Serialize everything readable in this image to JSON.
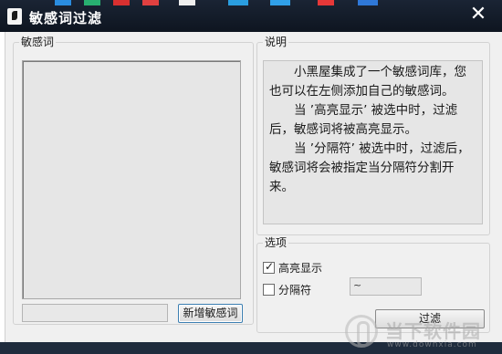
{
  "window": {
    "title": "敏感词过滤",
    "close_glyph": "✕"
  },
  "words_group": {
    "legend": "敏感词",
    "add_button": "新增敏感词",
    "new_word_value": ""
  },
  "desc_group": {
    "legend": "说明",
    "paragraphs": [
      "小黑屋集成了一个敏感词库，您也可以在左侧添加自己的敏感词。",
      "当 ’高亮显示’ 被选中时，过滤后，敏感词将被高亮显示。",
      "当 ’分隔符’ 被选中时，过滤后， 敏感词将会被指定当分隔符分割开来。"
    ]
  },
  "options_group": {
    "legend": "选项",
    "highlight": {
      "label": "高亮显示",
      "checked": true
    },
    "separator": {
      "label": "分隔符",
      "checked": false
    },
    "separator_value": "~",
    "filter_button": "过滤"
  },
  "watermark": {
    "text": "当下软件园",
    "url": "www.downxia.com"
  },
  "colors": {
    "titlebar": "#111a27",
    "dialog_bg": "#f0f0f0",
    "field_bg": "#e6e6e6"
  }
}
